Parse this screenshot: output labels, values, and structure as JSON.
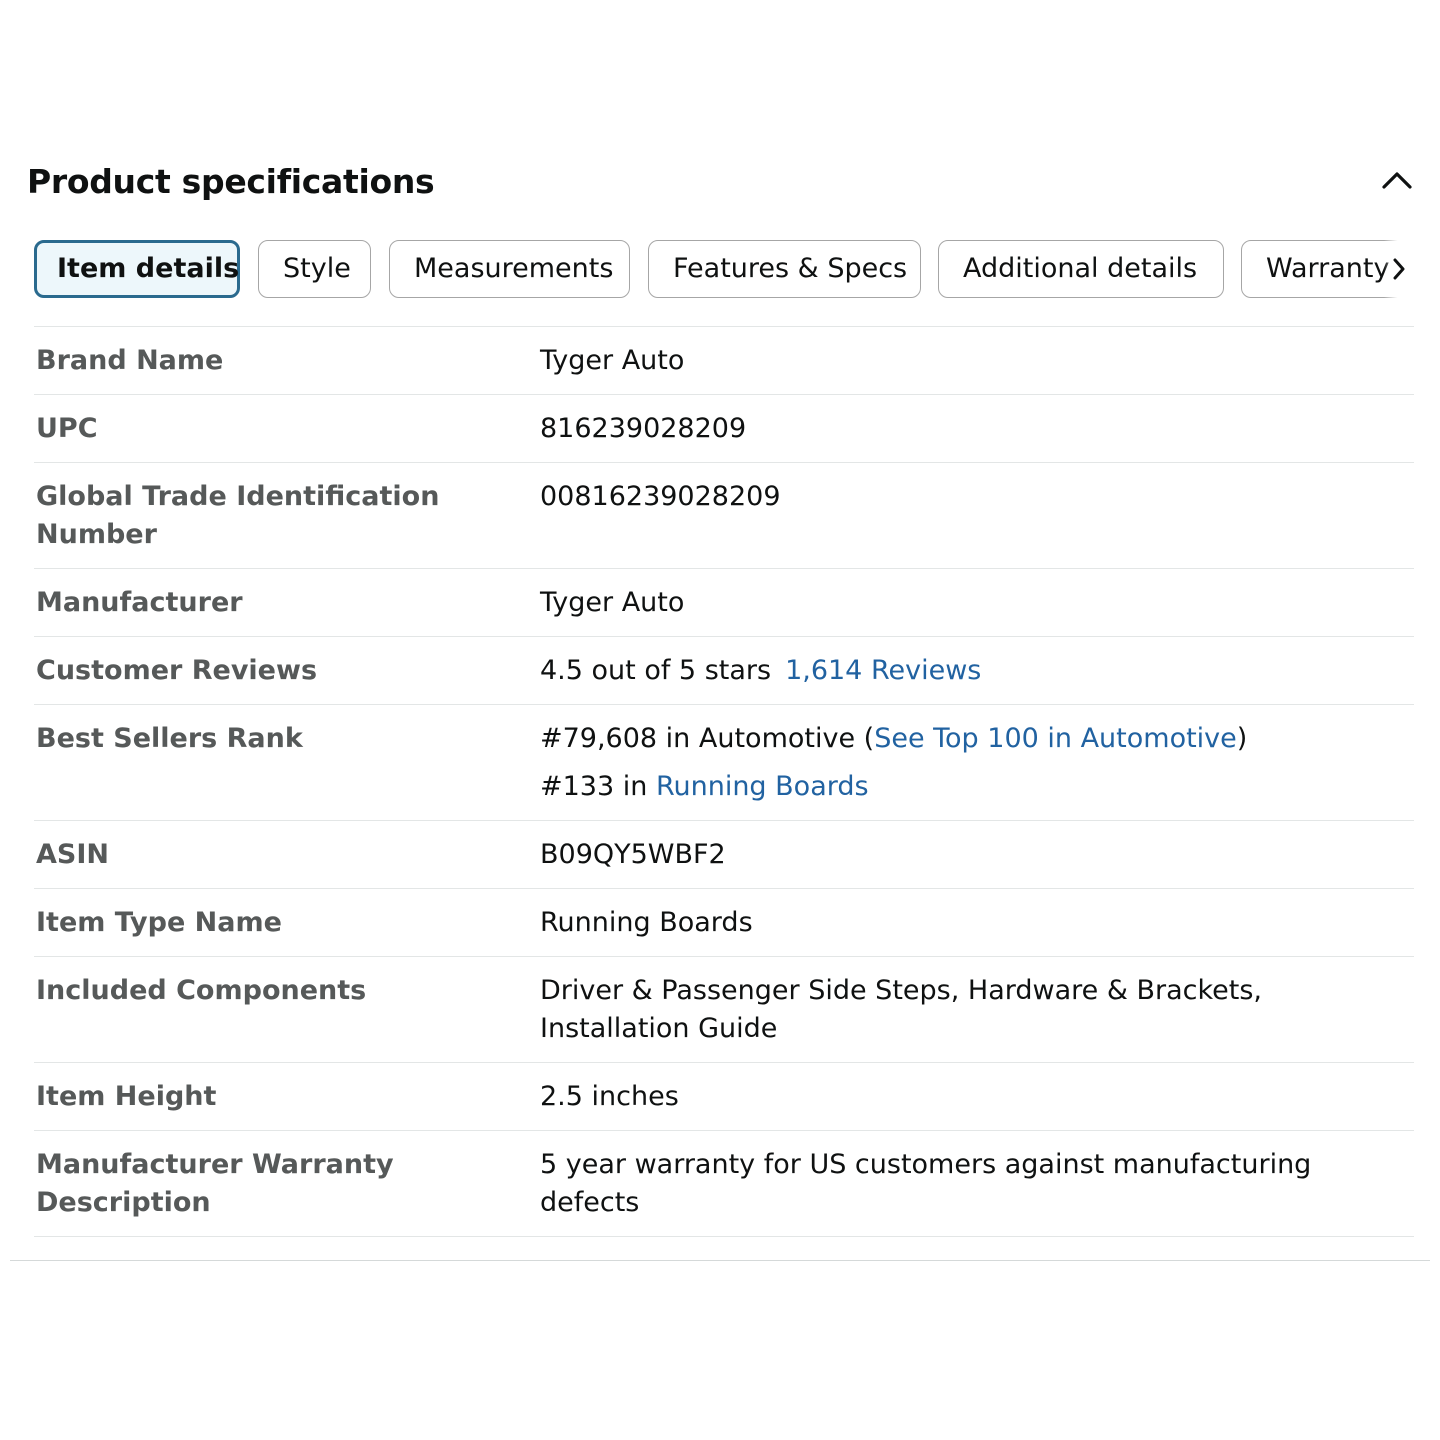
{
  "section": {
    "title": "Product specifications"
  },
  "icons": {
    "collapse": "chevron-up-icon",
    "tabs_next": "chevron-right-icon"
  },
  "colors": {
    "active_tab_border": "#2a6a8e",
    "active_tab_bg": "#edf7fb",
    "link": "#2162a1",
    "label": "#565959"
  },
  "tabs": [
    {
      "label": "Item details",
      "active": true
    },
    {
      "label": "Style",
      "active": false
    },
    {
      "label": "Measurements",
      "active": false
    },
    {
      "label": "Features & Specs",
      "active": false
    },
    {
      "label": "Additional details",
      "active": false
    },
    {
      "label": "Warranty",
      "active": false
    }
  ],
  "specs": {
    "brand_name": {
      "label": "Brand Name",
      "value": "Tyger Auto"
    },
    "upc": {
      "label": "UPC",
      "value": "816239028209"
    },
    "gtin": {
      "label": "Global Trade Identification Number",
      "value": "00816239028209"
    },
    "manufacturer": {
      "label": "Manufacturer",
      "value": "Tyger Auto"
    },
    "customer_reviews": {
      "label": "Customer Reviews",
      "rating_text": "4.5 out of 5 stars",
      "reviews_link": "1,614 Reviews"
    },
    "best_sellers_rank": {
      "label": "Best Sellers Rank",
      "rank1_text": "#79,608 in Automotive (",
      "rank1_link": "See Top 100 in Automotive",
      "rank1_close": ")",
      "rank2_text": "#133 in ",
      "rank2_link": "Running Boards"
    },
    "asin": {
      "label": "ASIN",
      "value": "B09QY5WBF2"
    },
    "item_type_name": {
      "label": "Item Type Name",
      "value": "Running Boards"
    },
    "included_components": {
      "label": "Included Components",
      "value": "Driver & Passenger Side Steps, Hardware & Brackets, Installation Guide"
    },
    "item_height": {
      "label": "Item Height",
      "value": "2.5 inches"
    },
    "warranty_description": {
      "label": "Manufacturer Warranty Description",
      "value": "5 year warranty for US customers against manufacturing defects"
    }
  }
}
